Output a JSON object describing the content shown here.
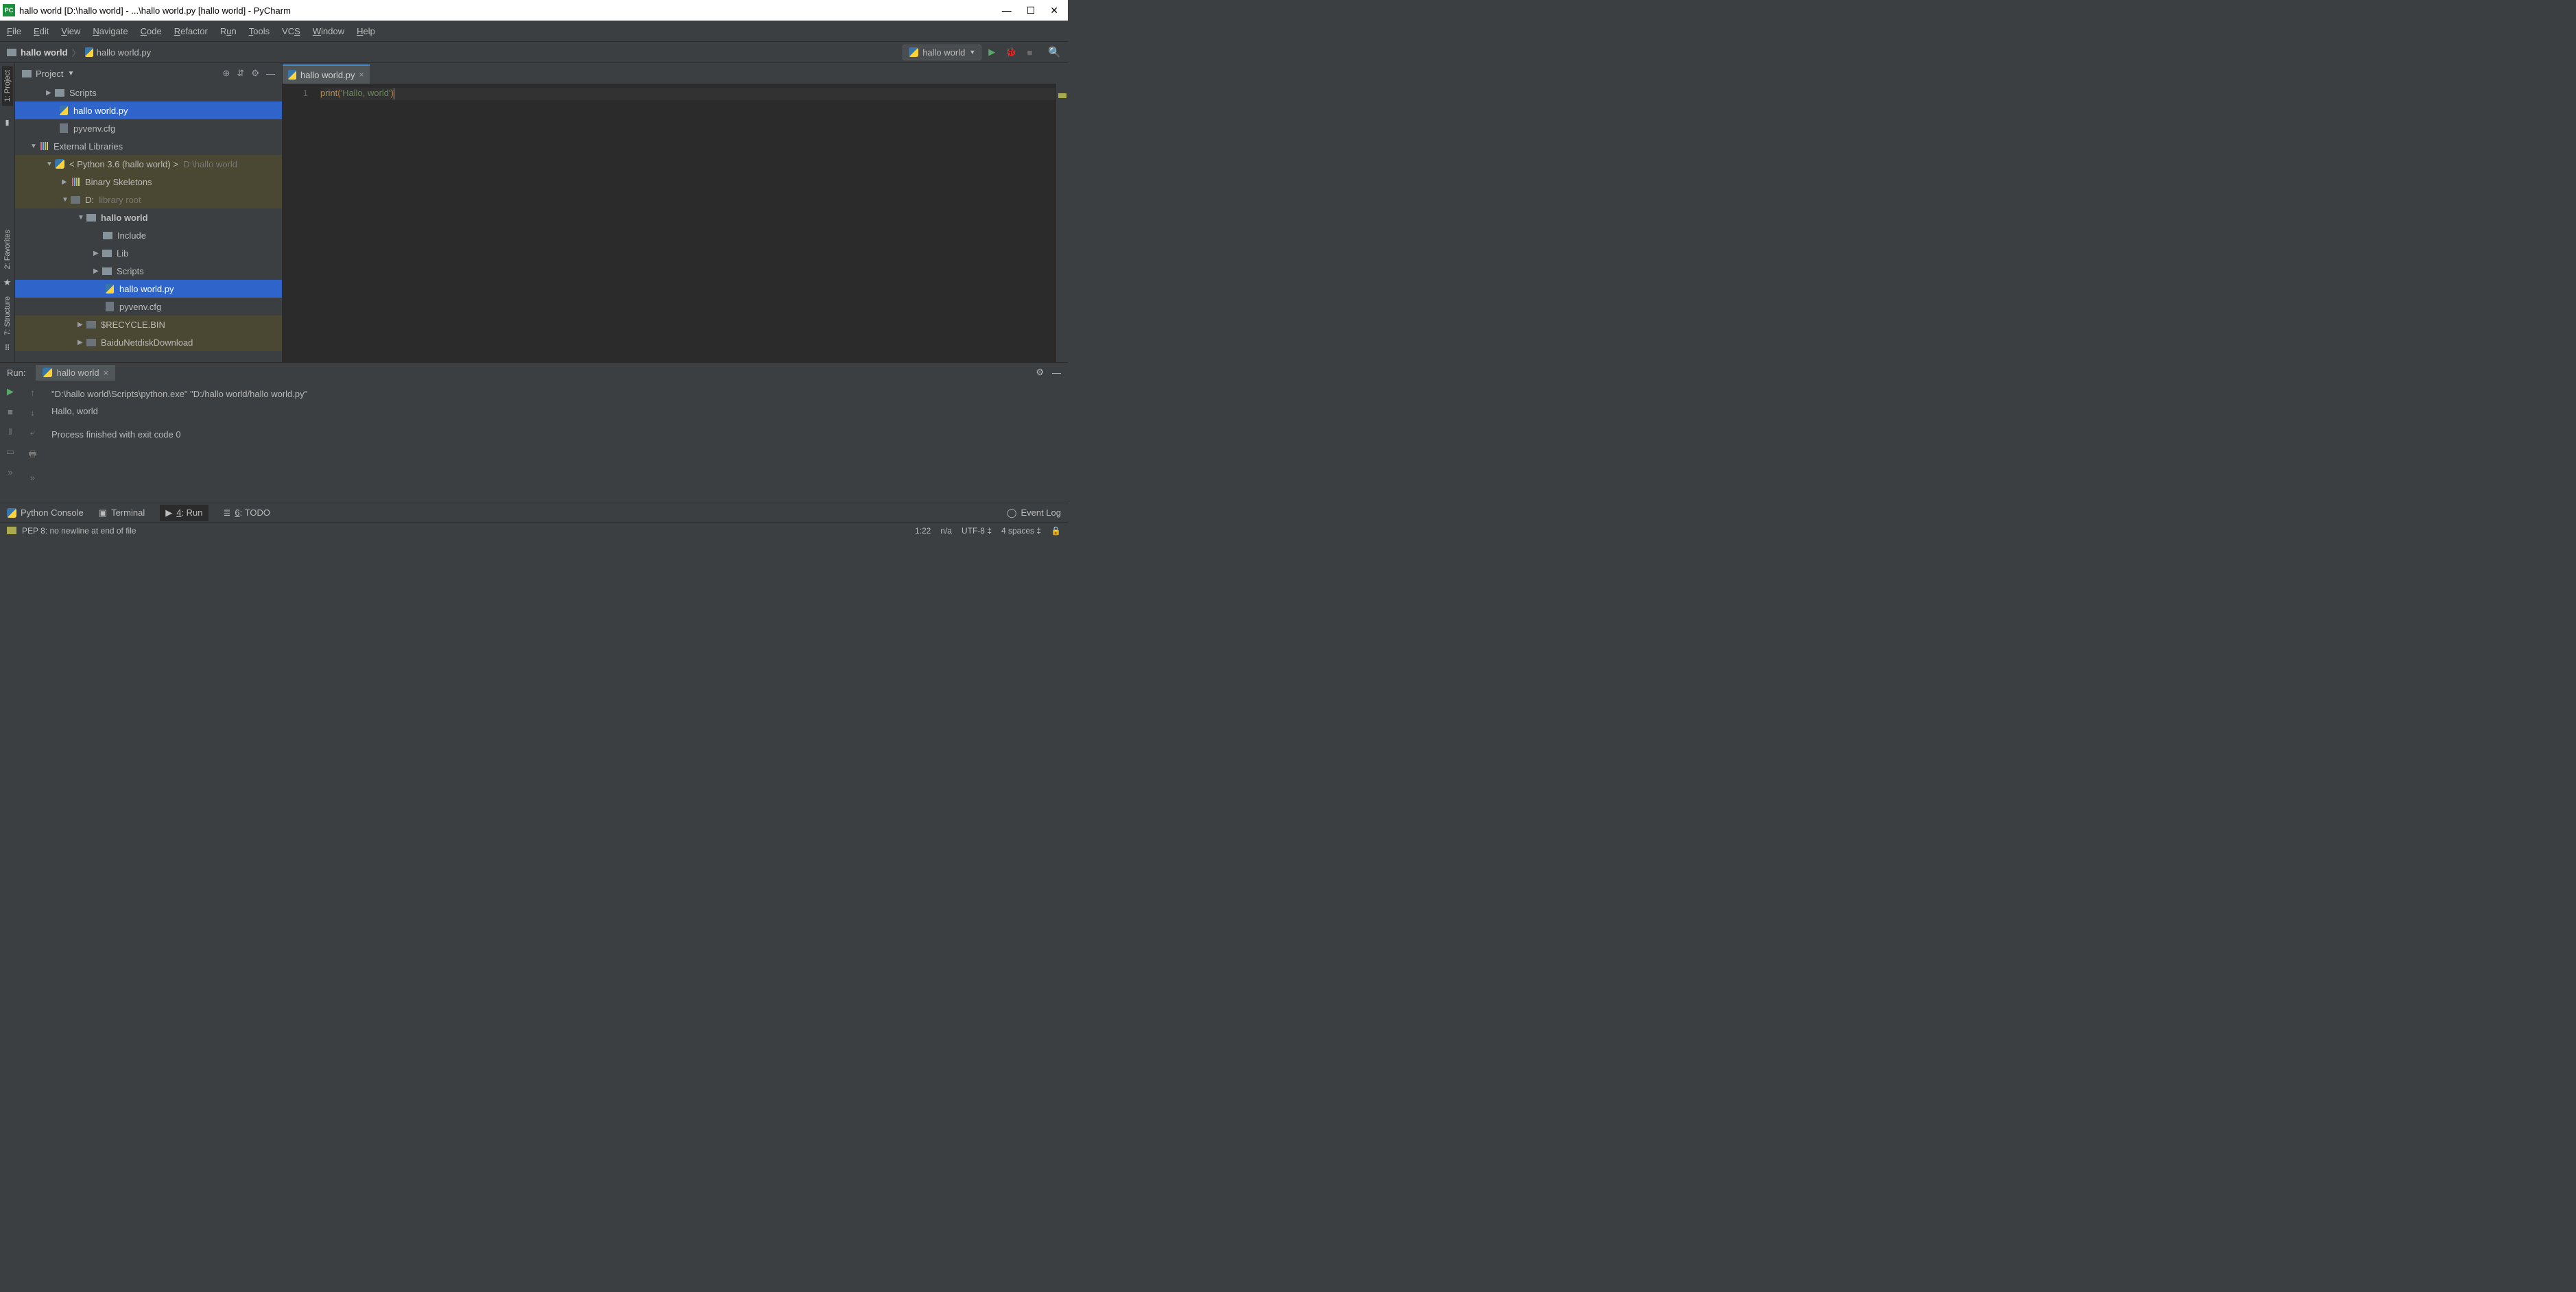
{
  "window": {
    "title": "hallo world [D:\\hallo world] - ...\\hallo world.py [hallo world] - PyCharm"
  },
  "menu": {
    "file": "File",
    "edit": "Edit",
    "view": "View",
    "navigate": "Navigate",
    "code": "Code",
    "refactor": "Refactor",
    "run": "Run",
    "tools": "Tools",
    "vcs": "VCS",
    "window": "Window",
    "help": "Help"
  },
  "breadcrumb": {
    "project": "hallo world",
    "file": "hallo world.py"
  },
  "runconfig": {
    "label": "hallo world"
  },
  "leftRail": {
    "project": "1: Project",
    "favorites": "2: Favorites",
    "structure": "7: Structure"
  },
  "sidebar": {
    "title": "Project"
  },
  "tree": {
    "scripts": "Scripts",
    "rootpy": "hallo world.py",
    "pyvenv": "pyvenv.cfg",
    "extlib": "External Libraries",
    "python": "< Python 3.6 (hallo world) >",
    "pythonPath": "D:\\hallo world",
    "binskel": "Binary Skeletons",
    "d": "D:",
    "dlabel": "library root",
    "hw": "hallo world",
    "include": "Include",
    "lib": "Lib",
    "scripts2": "Scripts",
    "hwpy": "hallo world.py",
    "pyvenv2": "pyvenv.cfg",
    "recycle": "$RECYCLE.BIN",
    "baidu": "BaiduNetdiskDownload"
  },
  "editor": {
    "tab": "hallo world.py",
    "lineNum": "1",
    "fn": "print",
    "p1": "(",
    "str": "'Hallo, world'",
    "p2": ")"
  },
  "runpanel": {
    "label": "Run:",
    "tab": "hallo world",
    "line1": "\"D:\\hallo world\\Scripts\\python.exe\" \"D:/hallo world/hallo world.py\"",
    "line2": "Hallo, world",
    "line3": "Process finished with exit code 0"
  },
  "bottom": {
    "pyconsole": "Python Console",
    "terminal": "Terminal",
    "run": "4: Run",
    "todo": "6: TODO",
    "eventlog": "Event Log"
  },
  "status": {
    "pep": "PEP 8: no newline at end of file",
    "pos": "1:22",
    "na": "n/a",
    "enc": "UTF-8 ‡",
    "indent": "4 spaces ‡"
  }
}
